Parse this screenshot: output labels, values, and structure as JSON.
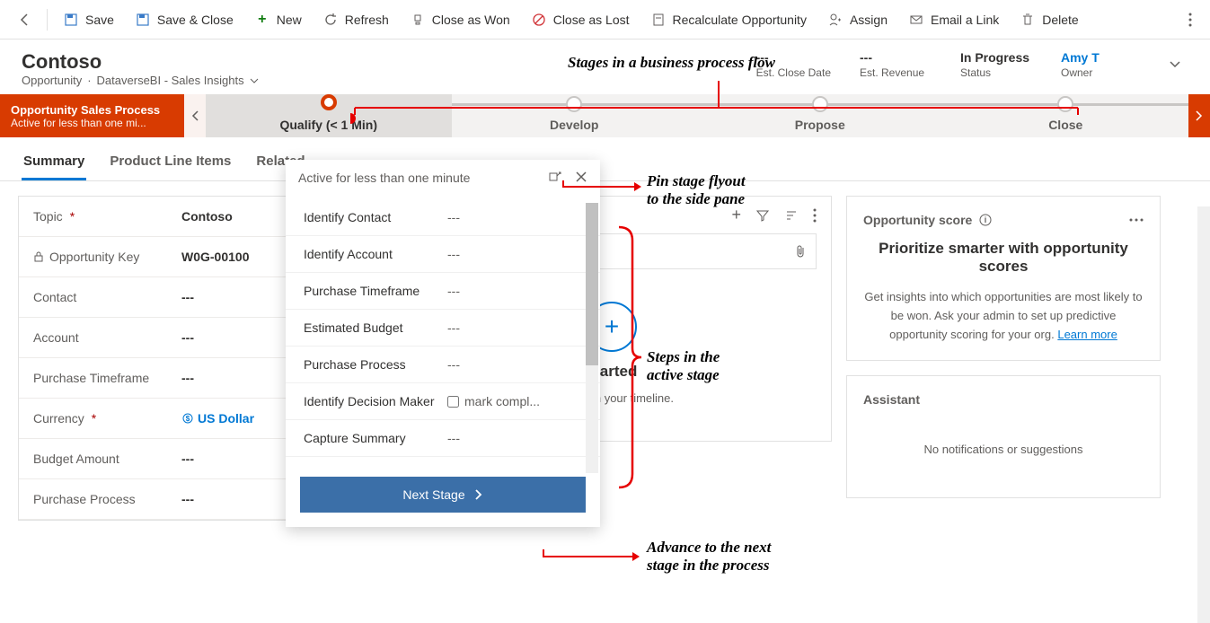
{
  "toolbar": {
    "save": "Save",
    "saveClose": "Save & Close",
    "new": "New",
    "refresh": "Refresh",
    "closeWon": "Close as Won",
    "closeLost": "Close as Lost",
    "recalc": "Recalculate Opportunity",
    "assign": "Assign",
    "emailLink": "Email a Link",
    "delete": "Delete"
  },
  "header": {
    "title": "Contoso",
    "breadcrumb1": "Opportunity",
    "breadcrumb2": "DataverseBI - Sales Insights",
    "closeDate": {
      "value": "---",
      "label": "Est. Close Date"
    },
    "revenue": {
      "value": "---",
      "label": "Est. Revenue"
    },
    "status": {
      "value": "In Progress",
      "label": "Status"
    },
    "owner": {
      "value": "Amy T",
      "label": "Owner"
    }
  },
  "bpf": {
    "processName": "Opportunity Sales Process",
    "processSub": "Active for less than one mi...",
    "stages": [
      "Qualify  (< 1 Min)",
      "Develop",
      "Propose",
      "Close"
    ]
  },
  "tabs": [
    "Summary",
    "Product Line Items",
    "Related"
  ],
  "details": {
    "topic": {
      "label": "Topic",
      "value": "Contoso"
    },
    "key": {
      "label": "Opportunity Key",
      "value": "W0G-00100"
    },
    "contact": {
      "label": "Contact",
      "value": "---"
    },
    "account": {
      "label": "Account",
      "value": "---"
    },
    "timeframe": {
      "label": "Purchase Timeframe",
      "value": "---"
    },
    "currency": {
      "label": "Currency",
      "value": "US Dollar"
    },
    "budget": {
      "label": "Budget Amount",
      "value": "---"
    },
    "process": {
      "label": "Purchase Process",
      "value": "---"
    }
  },
  "timeline": {
    "started": "started",
    "subtitle": "records in your timeline."
  },
  "rightPanel": {
    "scoreHeader": "Opportunity score",
    "scoreTitle": "Prioritize smarter with opportunity scores",
    "scoreBody": "Get insights into which opportunities are most likely to be won. Ask your admin to set up predictive opportunity scoring for your org.",
    "scoreLink": "Learn more",
    "assistantHeader": "Assistant",
    "assistantBody": "No notifications or suggestions"
  },
  "flyout": {
    "header": "Active for less than one minute",
    "steps": {
      "identifyContact": {
        "label": "Identify Contact",
        "value": "---"
      },
      "identifyAccount": {
        "label": "Identify Account",
        "value": "---"
      },
      "purchaseTimeframe": {
        "label": "Purchase Timeframe",
        "value": "---"
      },
      "estimatedBudget": {
        "label": "Estimated Budget",
        "value": "---"
      },
      "purchaseProcess": {
        "label": "Purchase Process",
        "value": "---"
      },
      "decisionMaker": {
        "label": "Identify Decision Maker",
        "value": "mark compl..."
      },
      "captureSummary": {
        "label": "Capture Summary",
        "value": "---"
      }
    },
    "nextBtn": "Next Stage"
  },
  "annotations": {
    "stages": "Stages in a business process flow",
    "pin1": "Pin stage flyout",
    "pin2": "to the side pane",
    "steps1": "Steps in the",
    "steps2": "active stage",
    "advance1": "Advance to the next",
    "advance2": "stage in the process"
  }
}
